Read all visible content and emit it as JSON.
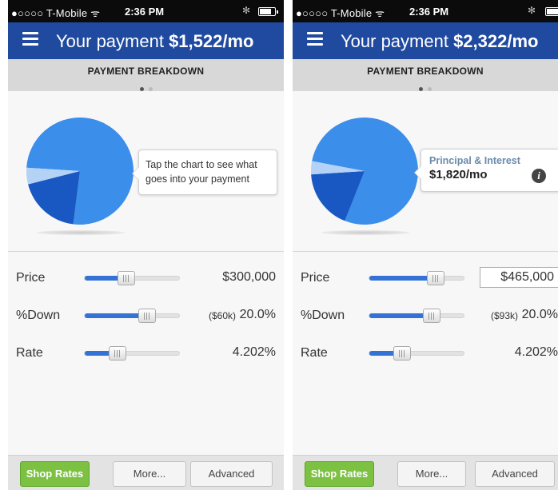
{
  "screens": [
    {
      "status": {
        "carrier": "●○○○○ T-Mobile ᯤ",
        "time": "2:36 PM"
      },
      "header": {
        "title_prefix": "Your payment ",
        "amount": "$1,522/mo"
      },
      "section": {
        "label": "PAYMENT BREAKDOWN",
        "page": 1,
        "pages": 2
      },
      "chart_data": {
        "type": "pie",
        "title": "",
        "slices": [
          {
            "share": 0.76,
            "color": "#3b8eea"
          },
          {
            "share": 0.19,
            "color": "#1957c2"
          },
          {
            "share": 0.05,
            "color": "#b3d2f5"
          }
        ]
      },
      "callout": {
        "text": "Tap the chart to see what goes into your payment"
      },
      "controls": {
        "price": {
          "label": "Price",
          "value": "$300,000",
          "level": 0.44
        },
        "down": {
          "label": "%Down",
          "amount": "($60k)",
          "value": "20.0%",
          "level": 0.66
        },
        "rate": {
          "label": "Rate",
          "value": "4.202%",
          "level": 0.35
        }
      },
      "footer": {
        "shop": "Shop Rates",
        "more": "More...",
        "advanced": "Advanced"
      }
    },
    {
      "status": {
        "carrier": "●○○○○ T-Mobile ᯤ",
        "time": "2:36 PM"
      },
      "header": {
        "title_prefix": "Your payment ",
        "amount": "$2,322/mo"
      },
      "section": {
        "label": "PAYMENT BREAKDOWN",
        "page": 1,
        "pages": 2
      },
      "chart_data": {
        "type": "pie",
        "title": "",
        "slices": [
          {
            "share": 0.78,
            "color": "#3b8eea"
          },
          {
            "share": 0.18,
            "color": "#1957c2"
          },
          {
            "share": 0.04,
            "color": "#b3d2f5"
          }
        ]
      },
      "callout": {
        "category": "Principal & Interest",
        "amount": "$1,820/mo",
        "info_glyph": "i"
      },
      "controls": {
        "price": {
          "label": "Price",
          "value": "$465,000",
          "level": 0.7
        },
        "down": {
          "label": "%Down",
          "amount": "($93k)",
          "value": "20.0%",
          "level": 0.66
        },
        "rate": {
          "label": "Rate",
          "value": "4.202%",
          "level": 0.35
        }
      },
      "footer": {
        "shop": "Shop Rates",
        "more": "More...",
        "advanced": "Advanced"
      }
    }
  ]
}
